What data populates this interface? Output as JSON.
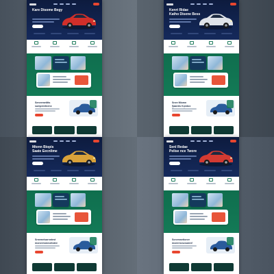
{
  "mockups": [
    {
      "id": "m1",
      "hero_title": "Kare Disome Begy",
      "car_color": "#d12f2a",
      "article_title": "Seneemetitts\nsumpreetnenx",
      "accent": "#e8462f"
    },
    {
      "id": "m2",
      "hero_title": "Kenrt Ridae\nKatho Disene Bess",
      "car_color": "#dfe3e8",
      "article_title": "Snee Miomn\nSaantrs Koedox\nGevrenentine",
      "accent": "#e8462f"
    },
    {
      "id": "m3",
      "hero_title": "Mtenn Biopis\nSaate Eecnlime",
      "car_color": "#d9a23a",
      "article_title": "Srnemeisarnntest\nmoneersmecdtotee",
      "accent": "#e8462f"
    },
    {
      "id": "m4",
      "hero_title": "Senl Redae\nPelise nce Twore",
      "car_color": "#d33a32",
      "article_title": "Scnemnetioner\nmoeerncscsomnf",
      "accent": "#e8462f"
    }
  ],
  "colors": {
    "hero_navy": "#0d1b3e",
    "brand_green": "#137a56",
    "accent_red": "#e8462f",
    "card_navy": "#143a5c"
  },
  "icons": [
    "car-image",
    "feature-icon",
    "photo-thumbnail"
  ]
}
